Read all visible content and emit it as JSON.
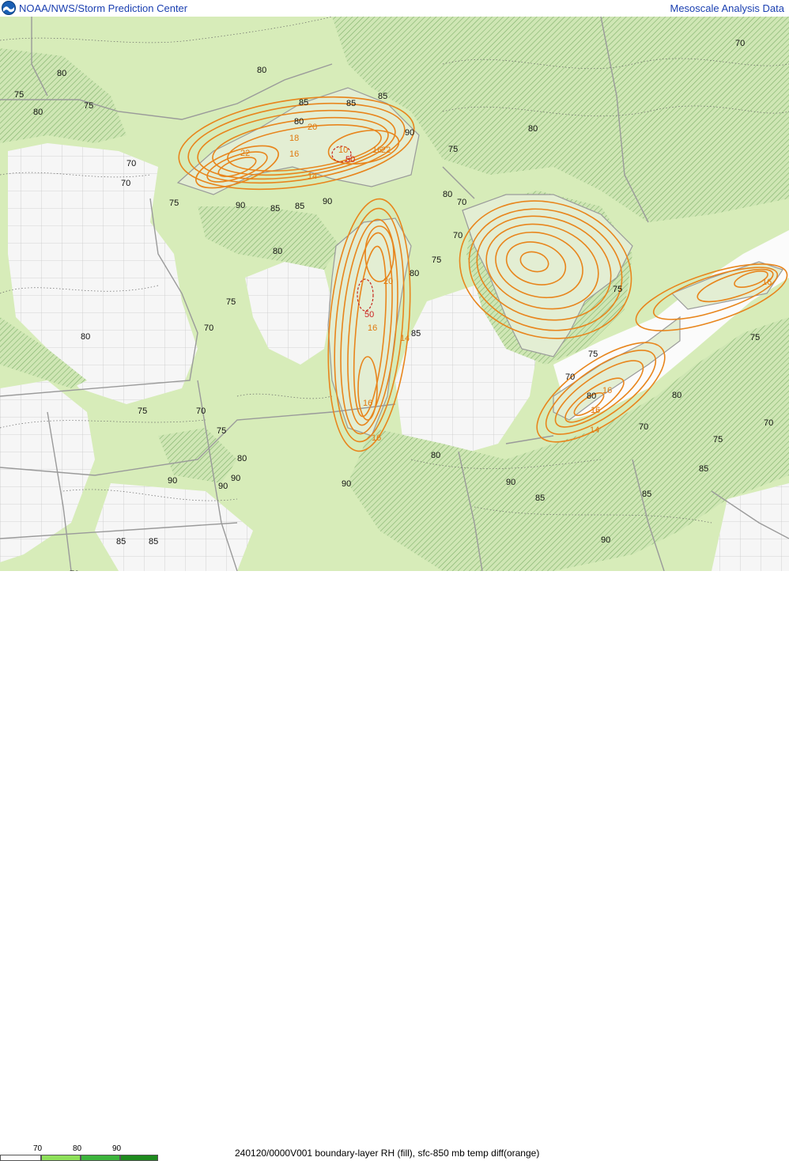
{
  "header": {
    "left_title": "NOAA/NWS/Storm Prediction Center",
    "right_title": "Mesoscale Analysis Data"
  },
  "footer": {
    "caption": "240120/0000V001 boundary-layer RH (fill), sfc-850 mb temp diff(orange)"
  },
  "legend": {
    "ticks": [
      "70",
      "80",
      "90"
    ],
    "swatch_colors": [
      "#ffffff",
      "#8ee05a",
      "#3cb43c",
      "#1e8a1e"
    ]
  },
  "colors": {
    "rh_70_80": "#d7ecb9",
    "rh_80_90_hatch": "#9ec98a",
    "dry": "#f4f4f4",
    "orange_contour": "#e8851c",
    "red_contour": "#c8281e",
    "borders": "#9a9a9a"
  },
  "map_labels": {
    "rh": [
      "80",
      "75",
      "80",
      "75",
      "70",
      "70",
      "75",
      "80",
      "85",
      "85",
      "80",
      "80",
      "85",
      "85",
      "75",
      "90",
      "90",
      "85",
      "90",
      "80",
      "70",
      "75",
      "70",
      "75",
      "80",
      "85",
      "80",
      "70",
      "80",
      "75",
      "75",
      "70",
      "80",
      "75",
      "70",
      "75",
      "80",
      "90",
      "90",
      "85",
      "70",
      "85",
      "90",
      "90",
      "80",
      "85",
      "90",
      "80",
      "70",
      "75",
      "70",
      "75",
      "85",
      "90",
      "85",
      "70"
    ],
    "orange": [
      "22",
      "20",
      "18",
      "16",
      "14",
      "22",
      "16",
      "10",
      "20",
      "16",
      "14",
      "16",
      "16",
      "16",
      "16",
      "14",
      "16"
    ],
    "red": [
      "50",
      "50"
    ]
  }
}
